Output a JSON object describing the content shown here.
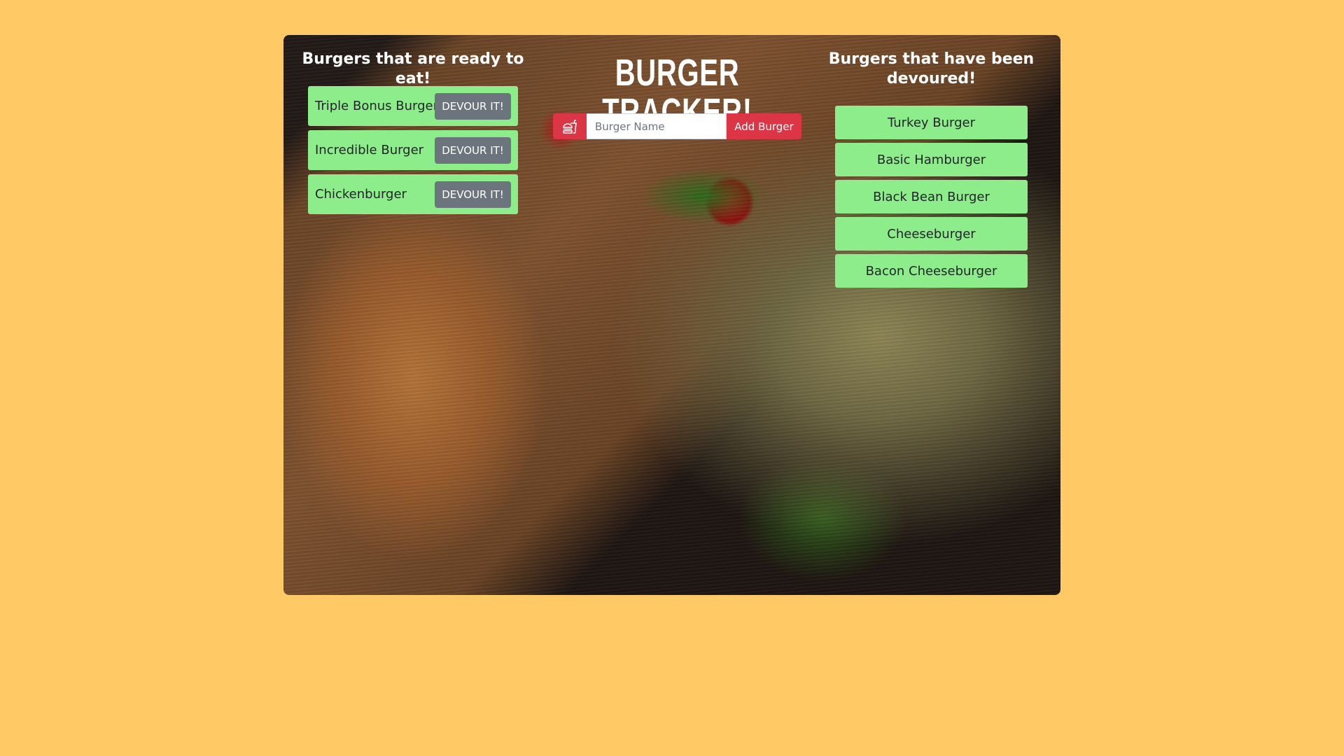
{
  "app": {
    "title": "BURGER TRACKER!"
  },
  "ready": {
    "heading": "Burgers that are ready to eat!",
    "items": [
      {
        "name": "Triple Bonus Burger",
        "button": "DEVOUR IT!"
      },
      {
        "name": "Incredible Burger",
        "button": "DEVOUR IT!"
      },
      {
        "name": "Chickenburger",
        "button": "DEVOUR IT!"
      }
    ]
  },
  "form": {
    "icon": "burger-soda-icon",
    "input_value": "",
    "input_placeholder": "Burger Name",
    "submit_label": "Add Burger"
  },
  "devoured": {
    "heading": "Burgers that have been devoured!",
    "items": [
      {
        "name": "Turkey Burger"
      },
      {
        "name": "Basic Hamburger"
      },
      {
        "name": "Black Bean Burger"
      },
      {
        "name": "Cheeseburger"
      },
      {
        "name": "Bacon Cheeseburger"
      }
    ]
  },
  "colors": {
    "page_background": "#ffc966",
    "item_green": "#8eed8b",
    "devour_button": "#6c757d",
    "accent_red": "#dc3545"
  }
}
